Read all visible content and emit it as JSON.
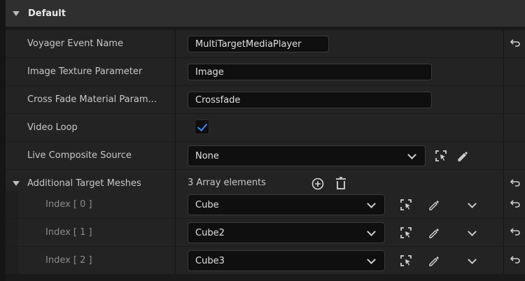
{
  "section": {
    "title": "Default"
  },
  "rows": {
    "voyager_event_name": {
      "label": "Voyager Event Name",
      "value": "MultiTargetMediaPlayer"
    },
    "image_texture_parameter": {
      "label": "Image Texture Parameter",
      "value": "Image"
    },
    "cross_fade": {
      "label": "Cross Fade Material Param...",
      "value": "Crossfade"
    },
    "video_loop": {
      "label": "Video Loop",
      "checked": true
    },
    "live_composite": {
      "label": "Live Composite Source",
      "value": "None"
    },
    "additional_meshes": {
      "label": "Additional Target Meshes",
      "count_text": "3 Array elements"
    }
  },
  "array_items": [
    {
      "label": "Index [ 0 ]",
      "value": "Cube"
    },
    {
      "label": "Index [ 1 ]",
      "value": "Cube2"
    },
    {
      "label": "Index [ 2 ]",
      "value": "Cube3"
    }
  ],
  "colors": {
    "accent": "#2f8bff",
    "panel": "#232323",
    "header": "#2f2f2f"
  },
  "icons": {
    "reset": "reset-arrow-icon",
    "browse": "browse-asset-icon",
    "pick": "eyedropper-icon",
    "add": "plus-circle-icon",
    "delete": "trash-icon"
  }
}
